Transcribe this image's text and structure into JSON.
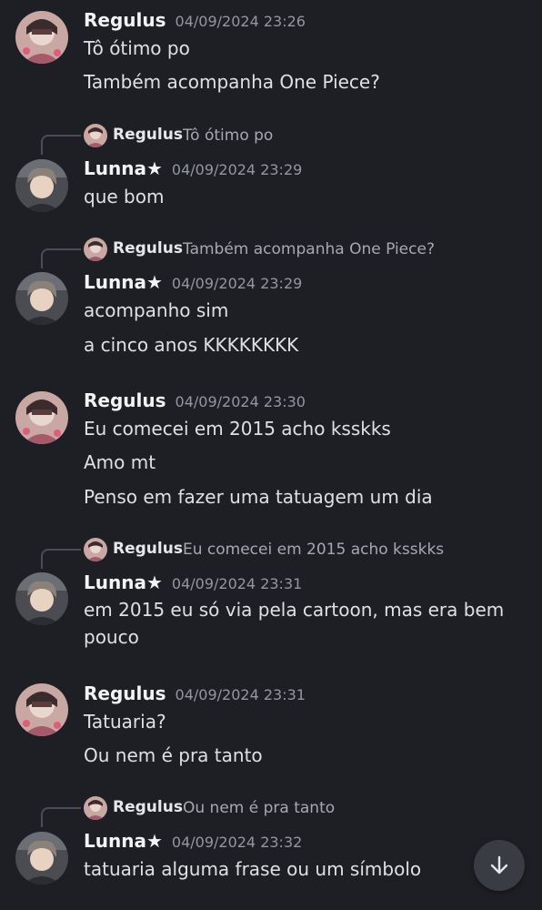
{
  "users": {
    "regulus": "Regulus",
    "lunna": "Lunna★"
  },
  "messages": [
    {
      "author": "Regulus",
      "timestamp": "04/09/2024 23:26",
      "lines": [
        "Tô ótimo po",
        "Também acompanha One Piece?"
      ]
    },
    {
      "reply_to": {
        "author": "Regulus",
        "text": "Tô ótimo po"
      },
      "author": "Lunna★",
      "timestamp": "04/09/2024 23:29",
      "lines": [
        "que bom"
      ]
    },
    {
      "reply_to": {
        "author": "Regulus",
        "text": "Também acompanha One Piece?"
      },
      "author": "Lunna★",
      "timestamp": "04/09/2024 23:29",
      "lines": [
        "acompanho sim",
        "a cinco anos KKKKKKKK"
      ]
    },
    {
      "author": "Regulus",
      "timestamp": "04/09/2024 23:30",
      "lines": [
        "Eu comecei em 2015 acho ksskks",
        "Amo mt",
        "Penso em fazer uma tatuagem um dia"
      ]
    },
    {
      "reply_to": {
        "author": "Regulus",
        "text": "Eu comecei em 2015 acho ksskks"
      },
      "author": "Lunna★",
      "timestamp": "04/09/2024 23:31",
      "lines": [
        "em 2015 eu só via pela cartoon, mas era bem pouco"
      ]
    },
    {
      "author": "Regulus",
      "timestamp": "04/09/2024 23:31",
      "lines": [
        "Tatuaria?",
        "Ou nem é pra tanto"
      ]
    },
    {
      "reply_to": {
        "author": "Regulus",
        "text": "Ou nem é pra tanto"
      },
      "author": "Lunna★",
      "timestamp": "04/09/2024 23:32",
      "lines": [
        "tatuaria alguma frase ou um símbolo"
      ]
    }
  ],
  "scroll_button": {
    "icon": "arrow-down-icon"
  },
  "colors": {
    "background": "#1e1f24",
    "text": "#dfe0e5",
    "timestamp": "#9497a0",
    "reply_text": "#a7a9b1"
  }
}
